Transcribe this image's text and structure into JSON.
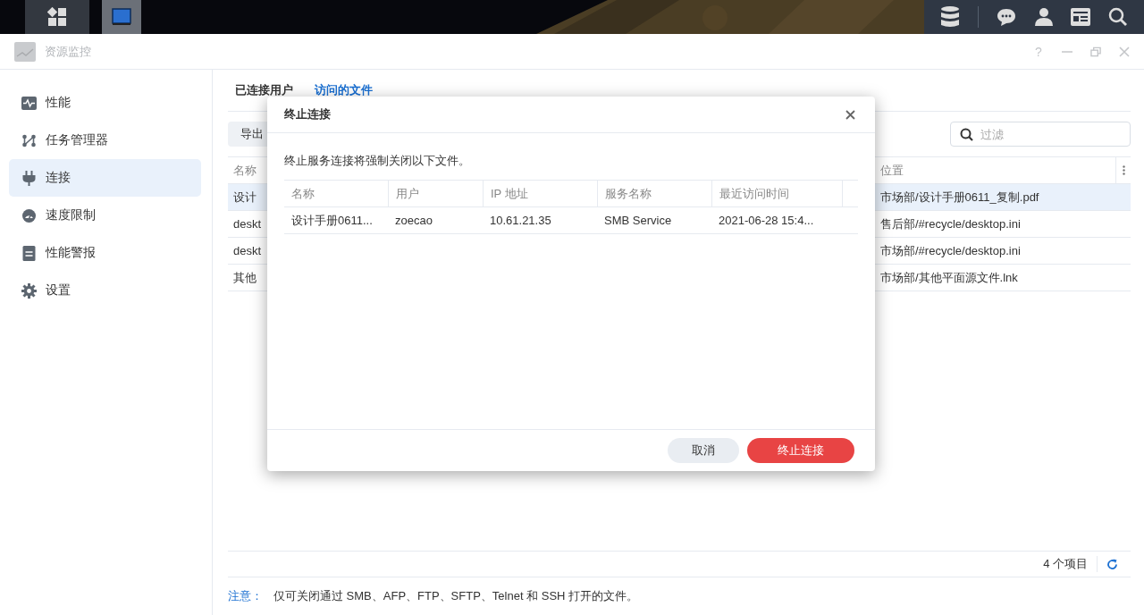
{
  "window": {
    "title": "资源监控",
    "controls": [
      {
        "kind": "help",
        "label": "?"
      },
      {
        "kind": "minimize"
      },
      {
        "kind": "restore"
      },
      {
        "kind": "close"
      }
    ]
  },
  "taskbar": {
    "apps": [
      {
        "kind": "grid",
        "selected": false
      },
      {
        "kind": "monitor",
        "selected": true
      }
    ],
    "tray": [
      {
        "kind": "storage"
      },
      {
        "kind": "chat"
      },
      {
        "kind": "user"
      },
      {
        "kind": "widgets"
      },
      {
        "kind": "search"
      }
    ]
  },
  "sidebar": {
    "items": [
      {
        "kind": "performance",
        "label": "性能",
        "selected": false
      },
      {
        "kind": "tasks",
        "label": "任务管理器",
        "selected": false
      },
      {
        "kind": "connection",
        "label": "连接",
        "selected": true
      },
      {
        "kind": "speed",
        "label": "速度限制",
        "selected": false
      },
      {
        "kind": "alert",
        "label": "性能警报",
        "selected": false
      },
      {
        "kind": "settings",
        "label": "设置",
        "selected": false
      }
    ]
  },
  "tabs": [
    {
      "label": "已连接用户",
      "selected": false
    },
    {
      "label": "访问的文件",
      "selected": true
    }
  ],
  "toolbar": {
    "export_button": "导出",
    "filter": {
      "placeholder": "过滤"
    }
  },
  "table": {
    "columns": [
      "名称",
      "位置"
    ],
    "rows": [
      {
        "name": "设计",
        "location": "市场部/设计手册0611_复制.pdf",
        "selected": true
      },
      {
        "name": "deskt",
        "location": "售后部/#recycle/desktop.ini",
        "selected": false
      },
      {
        "name": "deskt",
        "location": "市场部/#recycle/desktop.ini",
        "selected": false
      },
      {
        "name": "其他",
        "location": "市场部/其他平面源文件.lnk",
        "selected": false
      }
    ]
  },
  "status_bar": {
    "count": "4 个项目"
  },
  "note": {
    "label": "注意：",
    "text": "仅可关闭通过 SMB、AFP、FTP、SFTP、Telnet 和 SSH 打开的文件。"
  },
  "dialog": {
    "title": "终止连接",
    "message": "终止服务连接将强制关闭以下文件。",
    "columns": [
      "名称",
      "用户",
      "IP 地址",
      "服务名称",
      "最近访问时间"
    ],
    "rows": [
      [
        "设计手册0611...",
        "zoecao",
        "10.61.21.35",
        "SMB Service",
        "2021-06-28 15:4..."
      ]
    ],
    "buttons": [
      {
        "kind": "secondary",
        "label": "取消"
      },
      {
        "kind": "danger",
        "label": "终止连接"
      }
    ]
  }
}
